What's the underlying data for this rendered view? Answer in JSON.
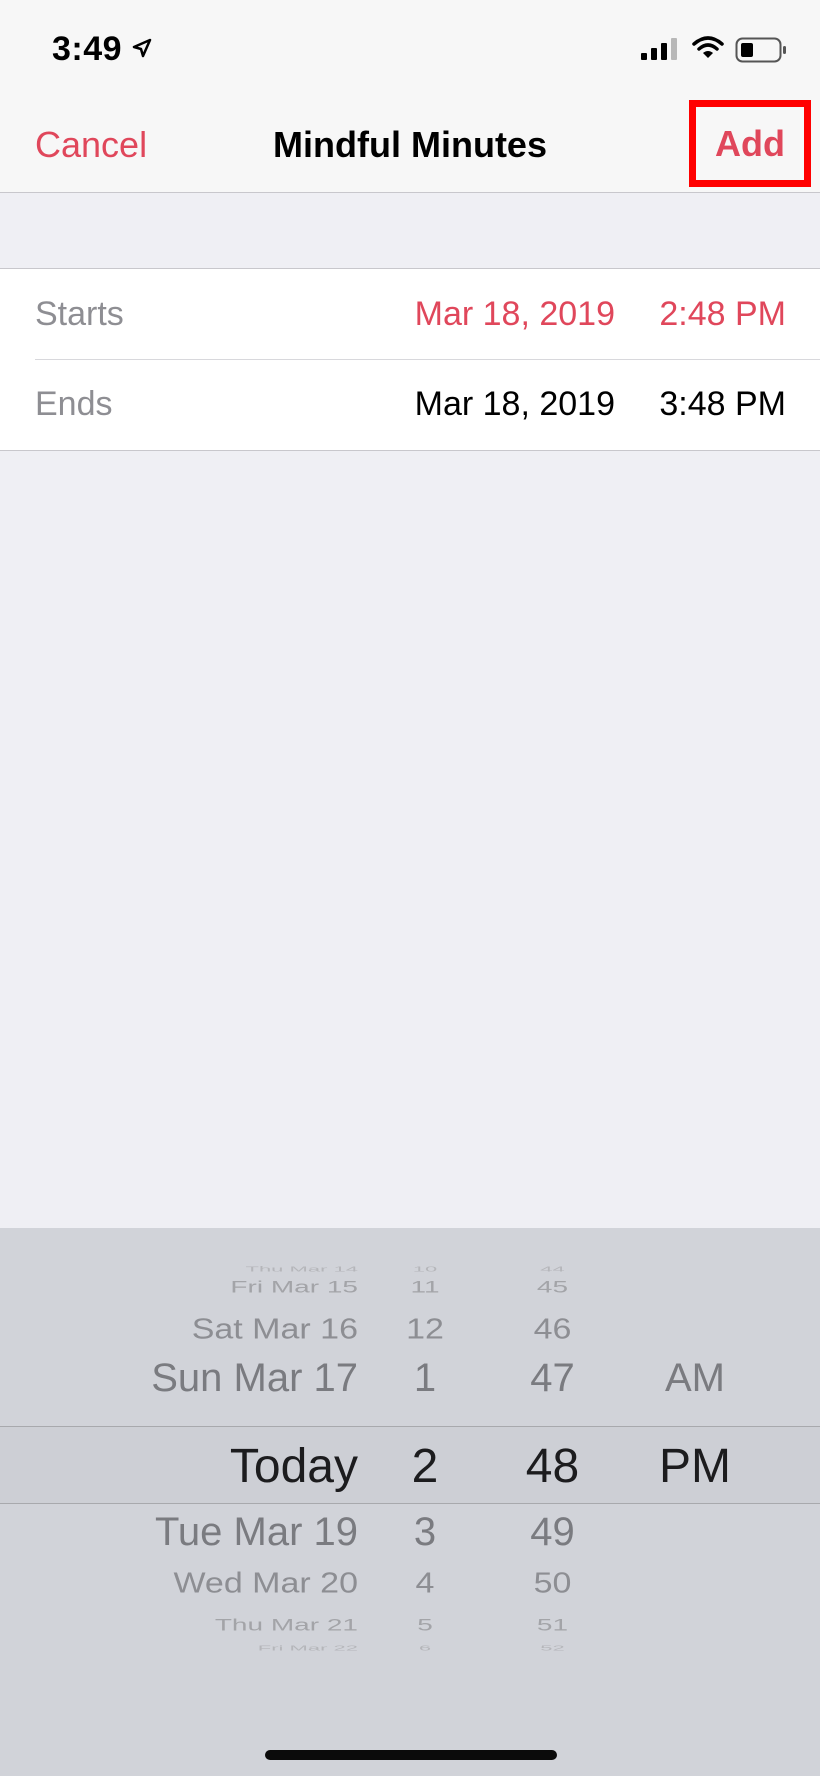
{
  "status_bar": {
    "time": "3:49",
    "icons": [
      "location-arrow-icon",
      "cellular-signal-icon",
      "wifi-icon",
      "battery-icon"
    ]
  },
  "nav": {
    "cancel": "Cancel",
    "title": "Mindful Minutes",
    "add": "Add"
  },
  "form": {
    "starts": {
      "label": "Starts",
      "date": "Mar 18, 2019",
      "time": "2:48 PM"
    },
    "ends": {
      "label": "Ends",
      "date": "Mar 18, 2019",
      "time": "3:48 PM"
    }
  },
  "picker": {
    "dates": [
      "Thu Mar 14",
      "Fri Mar 15",
      "Sat Mar 16",
      "Sun Mar 17",
      "Today",
      "Tue Mar 19",
      "Wed Mar 20",
      "Thu Mar 21",
      "Fri Mar 22"
    ],
    "hours": [
      "10",
      "11",
      "12",
      "1",
      "2",
      "3",
      "4",
      "5",
      "6"
    ],
    "minutes": [
      "44",
      "45",
      "46",
      "47",
      "48",
      "49",
      "50",
      "51",
      "52"
    ],
    "ampm": [
      "AM",
      "PM"
    ],
    "selected": {
      "date": "Today",
      "hour": "2",
      "minute": "48",
      "ampm": "PM"
    }
  },
  "colors": {
    "accent": "#e0475b",
    "highlight_box": "#ff0000",
    "background": "#efeff4",
    "picker_bg": "#d1d3d9"
  }
}
